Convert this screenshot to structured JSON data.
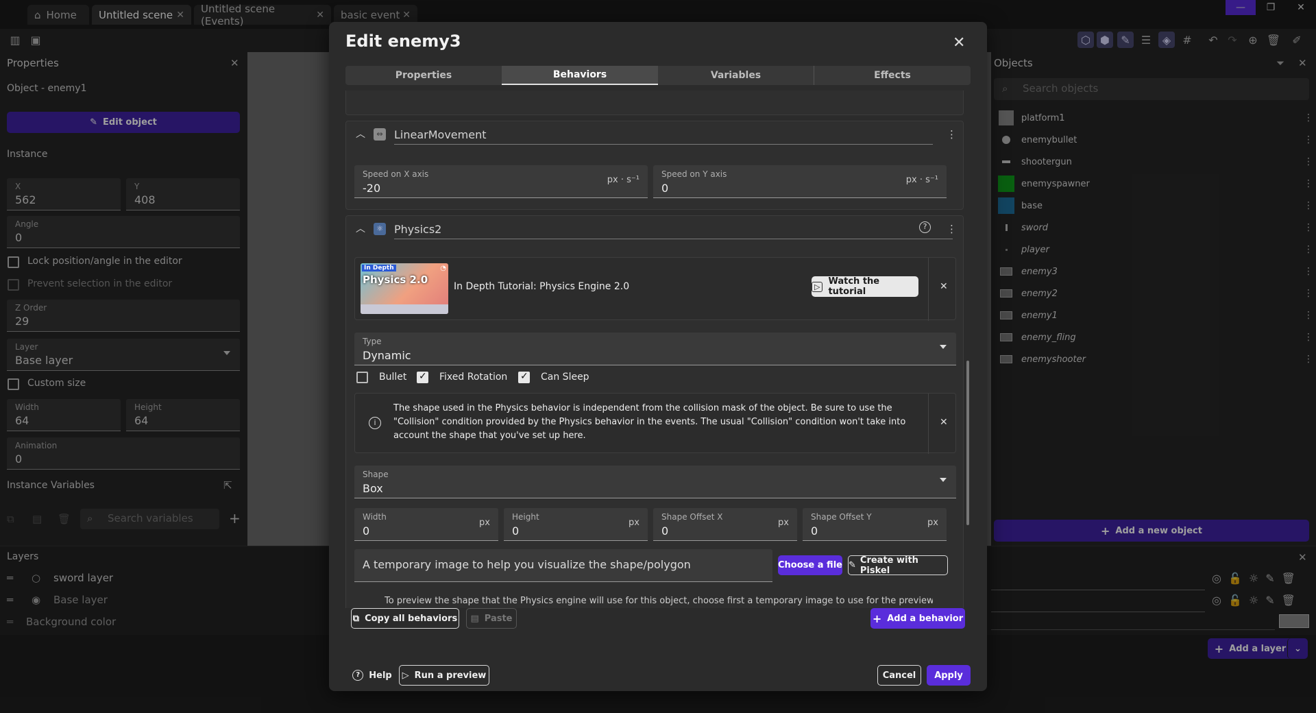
{
  "tabs": [
    {
      "label": "Home"
    },
    {
      "label": "Untitled scene"
    },
    {
      "label": "Untitled scene (Events)"
    },
    {
      "label": "basic event"
    }
  ],
  "properties": {
    "title": "Properties",
    "object_line": "Object  - enemy1",
    "edit_object": "Edit object",
    "instance_header": "Instance",
    "x_label": "X",
    "x_value": "562",
    "y_label": "Y",
    "y_value": "408",
    "angle_label": "Angle",
    "angle_value": "0",
    "lock_label": "Lock position/angle in the editor",
    "prevent_label": "Prevent selection in the editor",
    "z_label": "Z Order",
    "z_value": "29",
    "layer_label": "Layer",
    "layer_value": "Base layer",
    "custom_size_label": "Custom size",
    "width_label": "Width",
    "width_value": "64",
    "height_label": "Height",
    "height_value": "64",
    "animation_label": "Animation",
    "animation_value": "0",
    "instance_vars": "Instance Variables",
    "search_vars_placeholder": "Search variables"
  },
  "objects": {
    "title": "Objects",
    "search_placeholder": "Search objects",
    "add_new": "Add a new object",
    "items": [
      {
        "name": "platform1"
      },
      {
        "name": "enemybullet"
      },
      {
        "name": "shootergun"
      },
      {
        "name": "enemyspawner"
      },
      {
        "name": "base"
      },
      {
        "name": "sword"
      },
      {
        "name": "player"
      },
      {
        "name": "enemy3"
      },
      {
        "name": "enemy2"
      },
      {
        "name": "enemy1"
      },
      {
        "name": "enemy_fling"
      },
      {
        "name": "enemyshooter"
      }
    ]
  },
  "layers": {
    "title": "Layers",
    "items": [
      {
        "name": "sword layer"
      },
      {
        "name": "Base layer"
      }
    ],
    "background": "Background color",
    "add_layer": "Add a layer"
  },
  "modal": {
    "title": "Edit enemy3",
    "tabs": [
      {
        "label": "Properties"
      },
      {
        "label": "Behaviors"
      },
      {
        "label": "Variables"
      },
      {
        "label": "Effects"
      }
    ],
    "linear": {
      "name": "LinearMovement",
      "speed_x_label": "Speed on X axis",
      "speed_x_value": "-20",
      "speed_x_unit": "px · s⁻¹",
      "speed_y_label": "Speed on Y axis",
      "speed_y_value": "0",
      "speed_y_unit": "px · s⁻¹"
    },
    "physics": {
      "name": "Physics2",
      "tutorial_badge": "In Depth",
      "tutorial_thumb_title": "Physics 2.0",
      "tutorial_title": "In Depth Tutorial: Physics Engine 2.0",
      "watch_button": "Watch the tutorial",
      "type_label": "Type",
      "type_value": "Dynamic",
      "bullet_label": "Bullet",
      "fixed_rotation_label": "Fixed Rotation",
      "can_sleep_label": "Can Sleep",
      "info_text": "The shape used in the Physics behavior is independent from the collision mask of the object. Be sure to use the \"Collision\" condition provided by the Physics behavior in the events. The usual \"Collision\" condition won't take into account the shape that you've set up here.",
      "shape_label": "Shape",
      "shape_value": "Box",
      "width_label": "Width",
      "width_value": "0",
      "height_label": "Height",
      "height_value": "0",
      "offset_x_label": "Shape Offset X",
      "offset_x_value": "0",
      "offset_y_label": "Shape Offset Y",
      "offset_y_value": "0",
      "unit_px": "px",
      "image_placeholder": "A temporary image to help you visualize the shape/polygon",
      "choose_file": "Choose a file",
      "create_piskel": "Create with Piskel",
      "preview_note": "To preview the shape that the Physics engine will use for this object, choose first a temporary image to use for the preview."
    },
    "copy_all": "Copy all behaviors",
    "paste": "Paste",
    "add_behavior": "Add a behavior",
    "help": "Help",
    "run_preview": "Run a preview",
    "cancel": "Cancel",
    "apply": "Apply"
  },
  "colors": {
    "accent": "#5a2ddb",
    "enemyspawner": "#0f9a1a",
    "base": "#1e6f9c",
    "platform1": "#8a8a8a"
  }
}
